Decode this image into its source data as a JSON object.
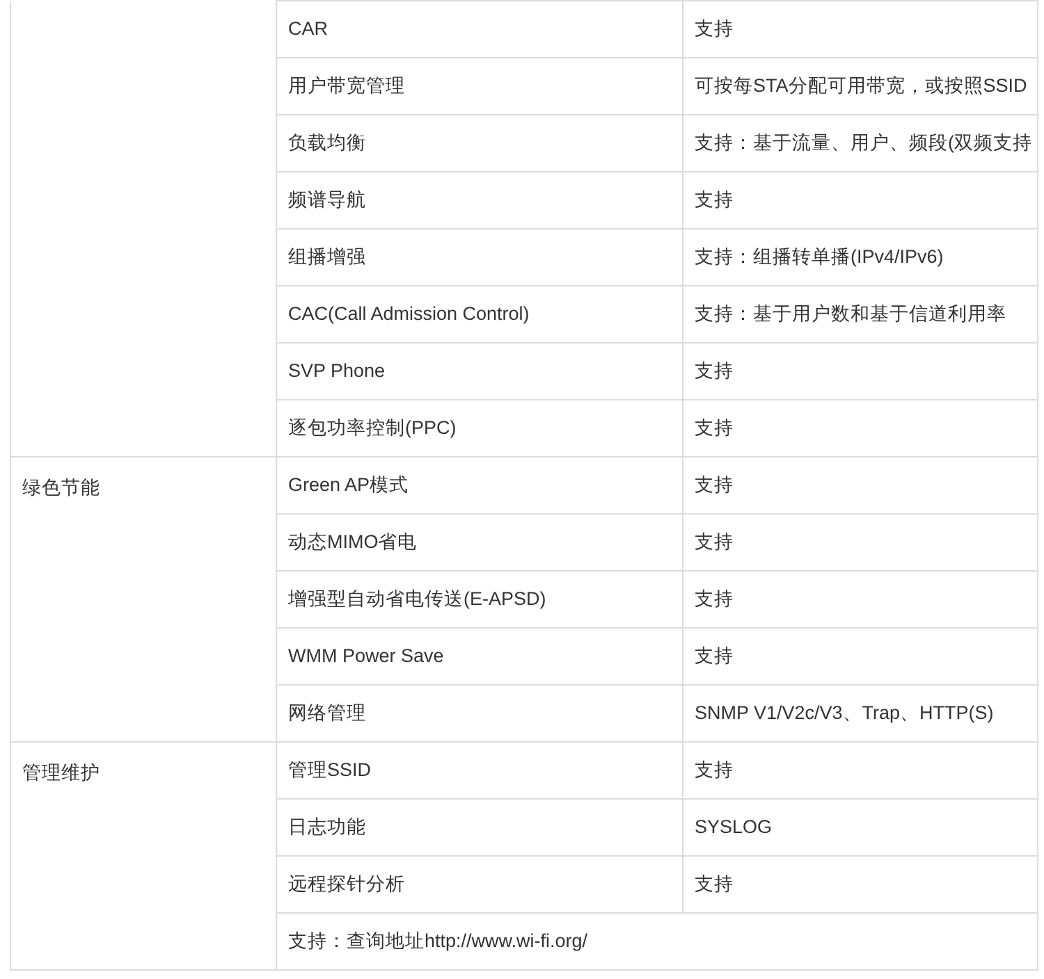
{
  "groups": [
    {
      "rows": [
        {
          "feature": "CAR",
          "value": "支持"
        },
        {
          "feature": "用户带宽管理",
          "value": "可按每STA分配可用带宽，或按照SSID"
        },
        {
          "feature": "负载均衡",
          "value": "支持：基于流量、用户、频段(双频支持"
        },
        {
          "feature": "频谱导航",
          "value": "支持"
        },
        {
          "feature": "组播增强",
          "value": "支持：组播转单播(IPv4/IPv6)"
        },
        {
          "feature": "CAC(Call Admission Control)",
          "value": "支持：基于用户数和基于信道利用率"
        },
        {
          "feature": "SVP Phone",
          "value": "支持"
        },
        {
          "feature": "逐包功率控制(PPC)",
          "value": "支持"
        }
      ]
    },
    {
      "category": "绿色节能",
      "rows": [
        {
          "feature": "Green AP模式",
          "value": "支持"
        },
        {
          "feature": "动态MIMO省电",
          "value": "支持"
        },
        {
          "feature": "增强型自动省电传送(E-APSD)",
          "value": "支持"
        },
        {
          "feature": "WMM Power Save",
          "value": "支持"
        },
        {
          "feature": "网络管理",
          "value": "SNMP V1/V2c/V3、Trap、HTTP(S)"
        }
      ]
    },
    {
      "category": "管理维护",
      "rows": [
        {
          "feature": "管理SSID",
          "value": "支持"
        },
        {
          "feature": "日志功能",
          "value": "SYSLOG"
        },
        {
          "feature": "远程探针分析",
          "value": "支持"
        },
        {
          "merged": "支持：查询地址http://www.wi-fi.org/"
        }
      ]
    }
  ]
}
